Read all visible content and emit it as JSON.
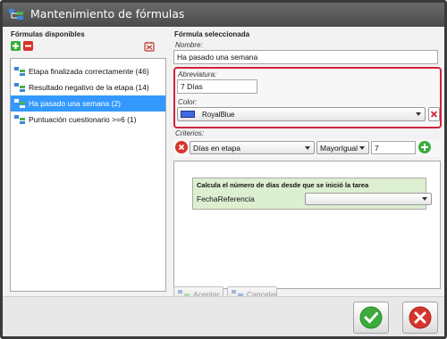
{
  "window": {
    "title": "Mantenimiento de fórmulas"
  },
  "left_panel": {
    "title": "Fórmulas disponibles",
    "items": [
      {
        "label": "Etapa finalizada correctamente (46)",
        "selected": false
      },
      {
        "label": "Resultado negativo de la etapa (14)",
        "selected": false
      },
      {
        "label": "Ha pasado una semana (2)",
        "selected": true
      },
      {
        "label": "Puntuación cuestionario >=6 (1)",
        "selected": false
      }
    ]
  },
  "right_panel": {
    "title": "Fórmula seleccionada",
    "nombre_label": "Nombre:",
    "nombre_value": "Ha pasado una semana",
    "abreviatura_label": "Abreviatura:",
    "abreviatura_value": "7 Días",
    "color_label": "Color:",
    "color_value": "RoyalBlue",
    "color_swatch": "#4169e1",
    "criterios_label": "Criterios:",
    "criterion": {
      "field": "Días en etapa",
      "operator": "MayorIgual",
      "value": "7",
      "description": "Calcula el número de días desde que se inició la tarea",
      "param_label": "FechaReferencia",
      "param_value": ""
    },
    "accept_label": "Aceptar",
    "cancel_label": "Cancelar"
  },
  "colors": {
    "highlight": "#d0233d",
    "selection": "#3399ff",
    "green_panel": "#dcefd0"
  }
}
